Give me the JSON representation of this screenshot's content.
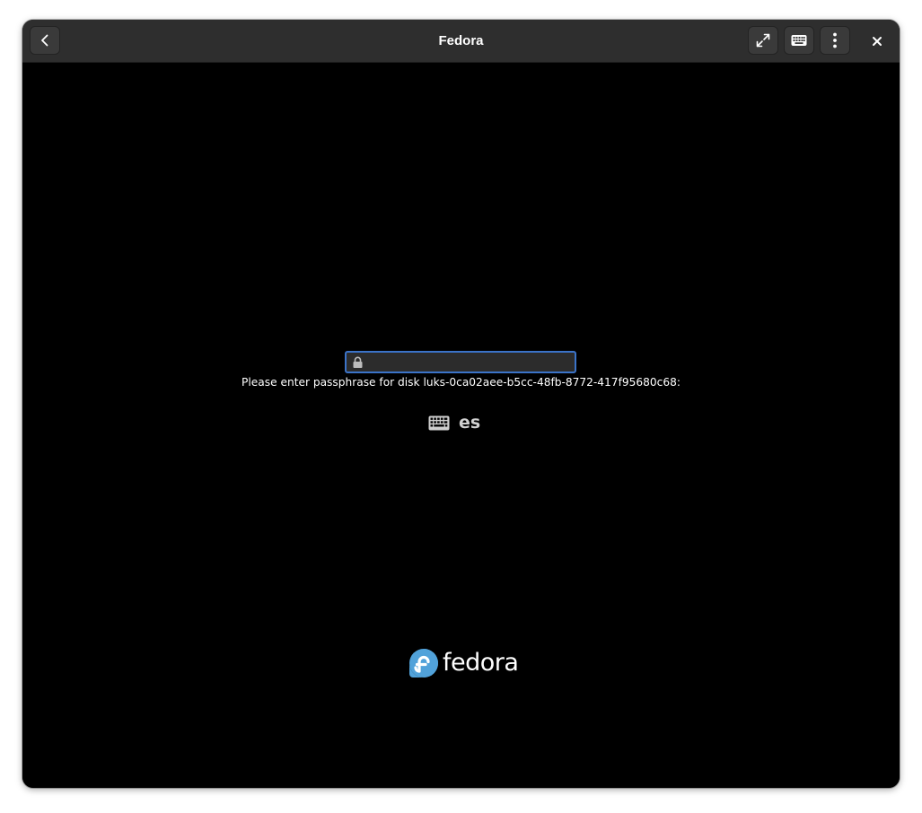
{
  "window": {
    "title": "Fedora"
  },
  "headerbar": {
    "back_icon": "chevron-left-icon",
    "fullscreen_icon": "fullscreen-icon",
    "keyboard_icon": "keyboard-icon",
    "menu_icon": "vertical-dots-menu-icon",
    "close_icon": "close-icon"
  },
  "unlock": {
    "passphrase_value": "",
    "prompt": "Please enter passphrase for disk luks-0ca02aee-b5cc-48fb-8772-417f95680c68:",
    "keyboard_layout": "es"
  },
  "branding": {
    "logo_text": "fedora"
  },
  "colors": {
    "headerbar": "#2e2e2e",
    "screen": "#000000",
    "field_border": "#3b73c8",
    "field_bg": "#2c2c2c",
    "fedora_blue": "#51a2da"
  }
}
